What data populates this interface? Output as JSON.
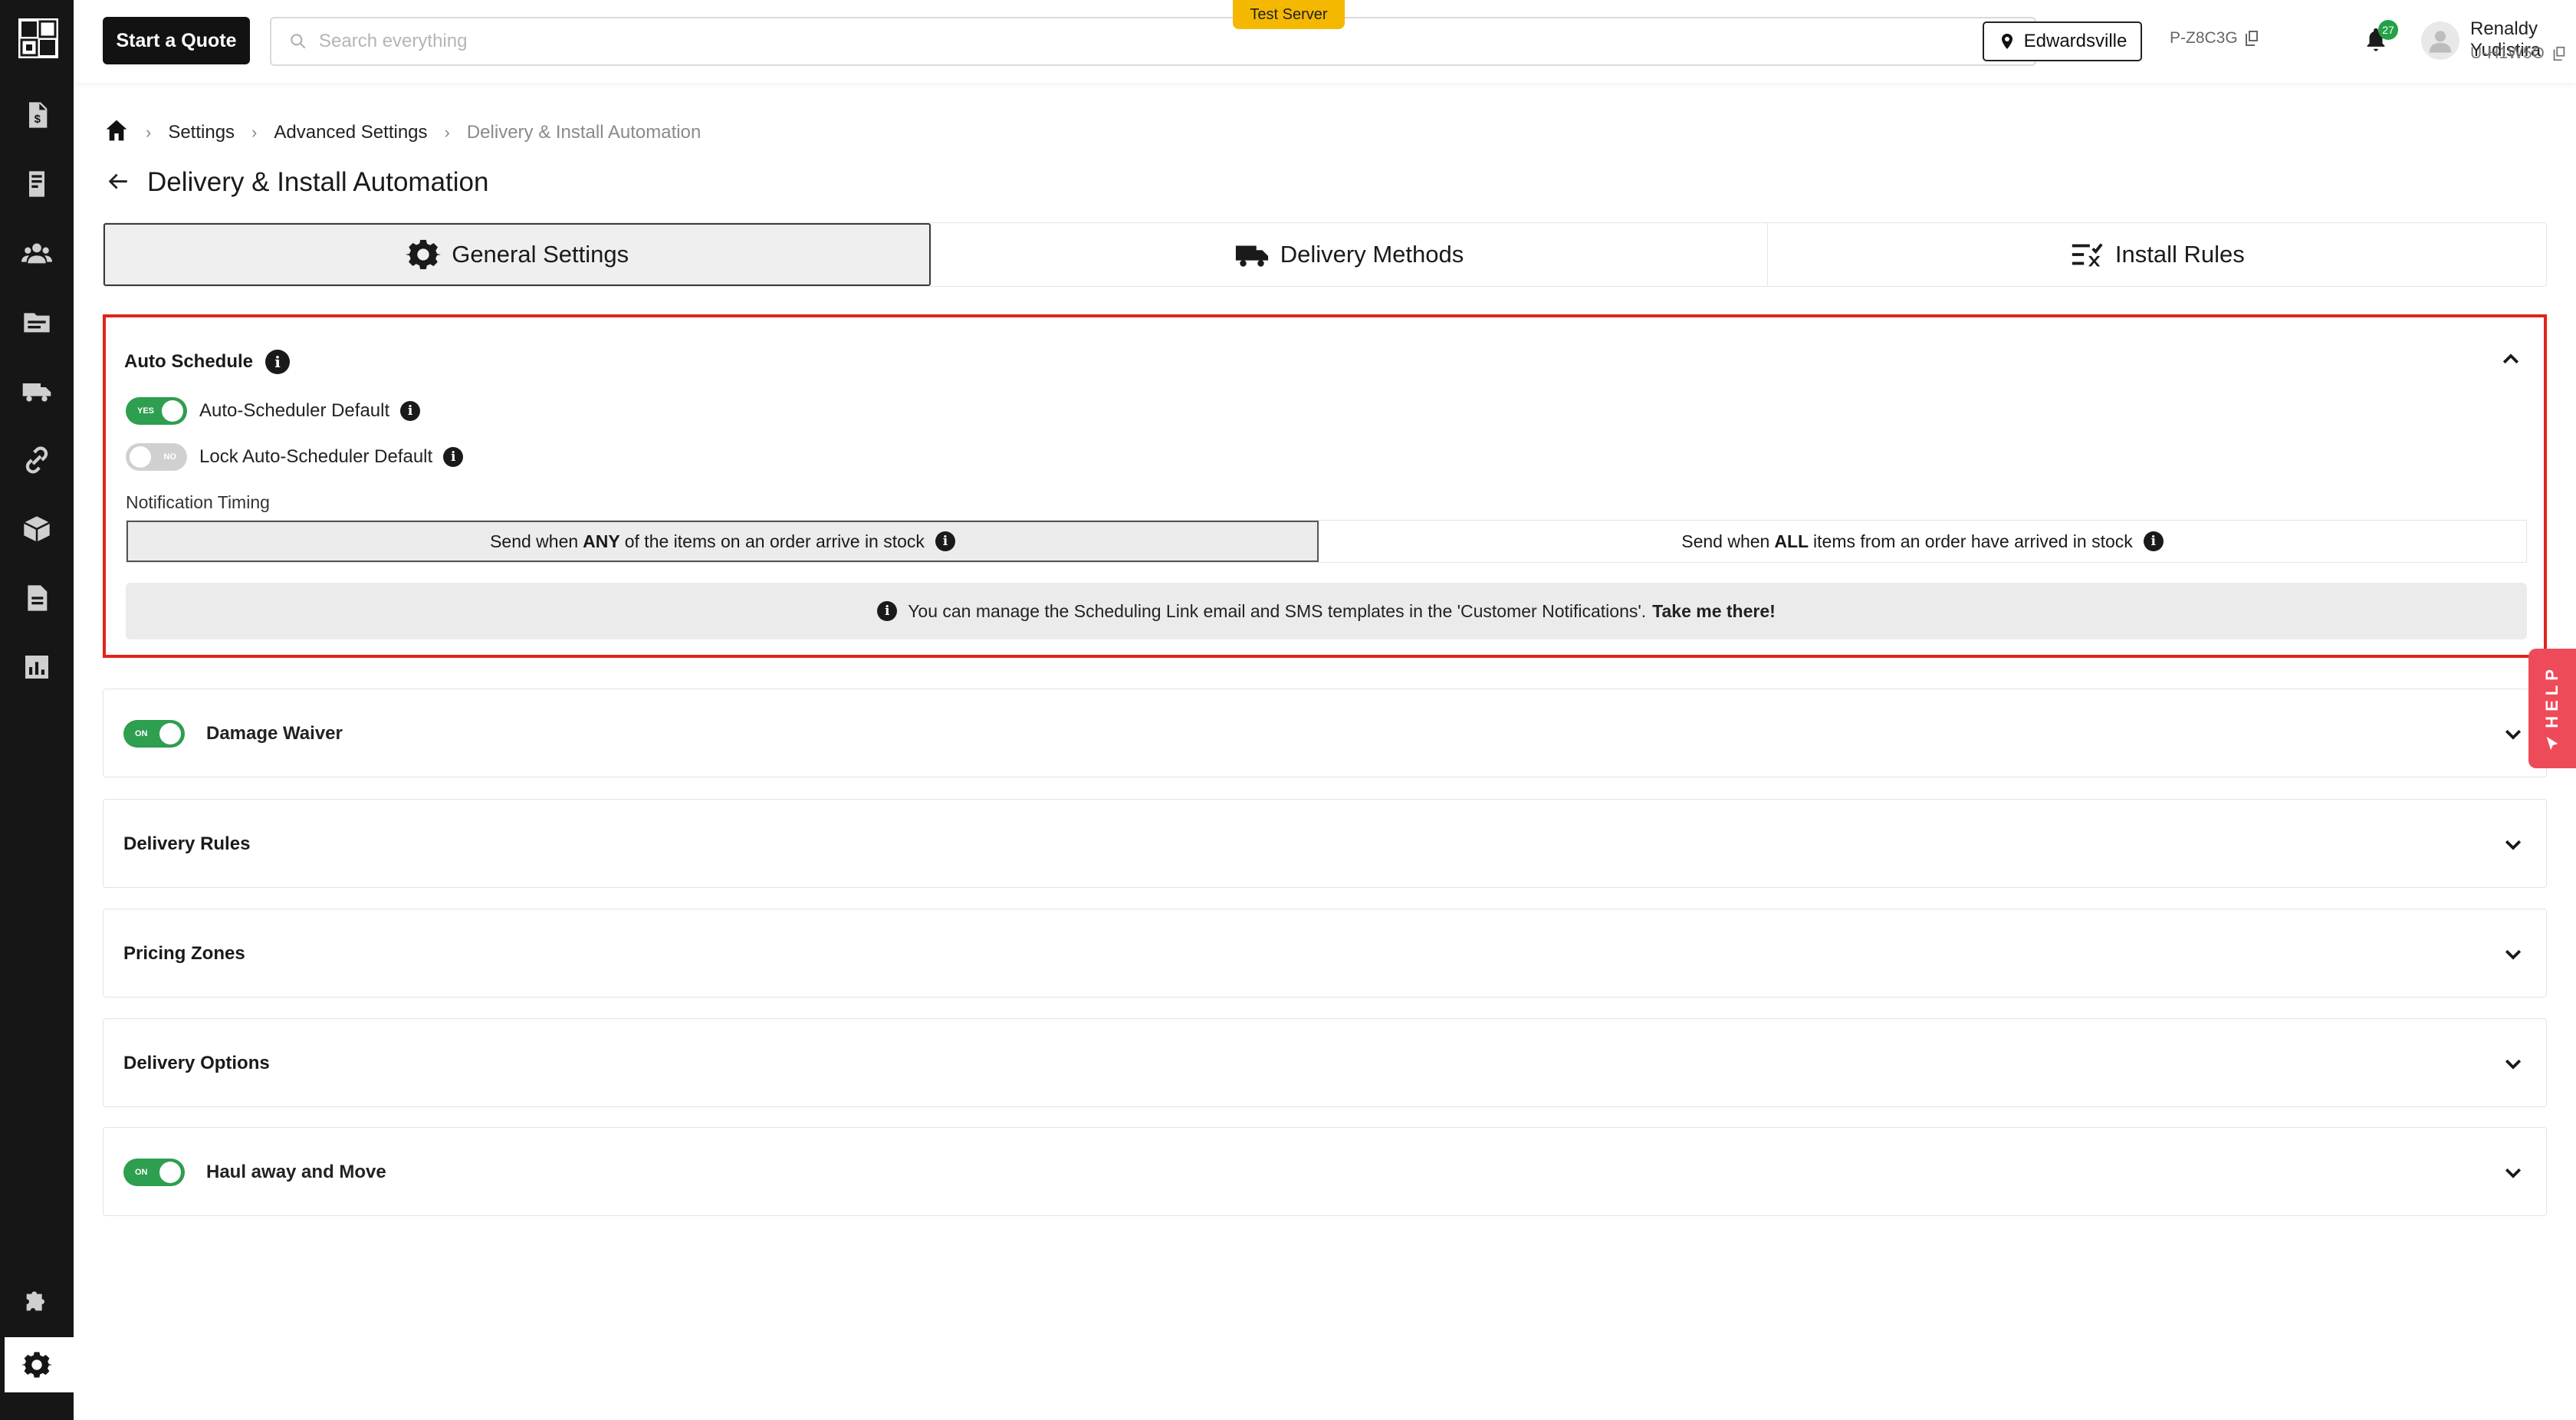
{
  "topbar": {
    "quote_button": "Start a Quote",
    "search_placeholder": "Search everything",
    "server_badge": "Test Server",
    "location": "Edwardsville",
    "project_code": "P-Z8C3G",
    "notification_count": "27",
    "user_name": "Renaldy Yudistira",
    "user_id": "U-H1W5O"
  },
  "sidebar": {
    "items": [
      {
        "icon": "invoice-icon"
      },
      {
        "icon": "register-icon"
      },
      {
        "icon": "customers-icon"
      },
      {
        "icon": "folder-icon"
      },
      {
        "icon": "truck-icon"
      },
      {
        "icon": "link-icon"
      },
      {
        "icon": "box-icon"
      },
      {
        "icon": "document-icon"
      },
      {
        "icon": "chart-icon"
      },
      {
        "icon": "puzzle-icon"
      },
      {
        "icon": "gear-icon",
        "active": true
      }
    ]
  },
  "breadcrumb": {
    "items": [
      "Settings",
      "Advanced Settings",
      "Delivery & Install Automation"
    ]
  },
  "page": {
    "title": "Delivery & Install Automation"
  },
  "tabs": [
    {
      "label": "General Settings",
      "icon": "gear-icon",
      "active": true
    },
    {
      "label": "Delivery Methods",
      "icon": "truck-icon"
    },
    {
      "label": "Install Rules",
      "icon": "list-check-icon"
    }
  ],
  "auto_schedule": {
    "title": "Auto Schedule",
    "toggle1": {
      "label": "Auto-Scheduler Default",
      "state": "YES"
    },
    "toggle2": {
      "label": "Lock Auto-Scheduler Default",
      "state": "NO"
    },
    "notification_label": "Notification Timing",
    "option1": {
      "pre": "Send when",
      "bold": "ANY",
      "post": "of the items on an order arrive in stock",
      "selected": true
    },
    "option2": {
      "pre": "Send when",
      "bold": "ALL",
      "post": "items from an order have arrived in stock"
    },
    "notice": {
      "text": "You can manage the Scheduling Link email and SMS templates in the 'Customer Notifications'.",
      "link": "Take me there!"
    }
  },
  "sections": [
    {
      "title": "Damage Waiver",
      "toggle": "ON"
    },
    {
      "title": "Delivery Rules"
    },
    {
      "title": "Pricing Zones"
    },
    {
      "title": "Delivery Options"
    },
    {
      "title": "Haul away and Move",
      "toggle": "ON"
    }
  ],
  "help": {
    "label": "HELP"
  },
  "colors": {
    "accent_dark": "#121212",
    "toggle_on": "#2e9e4f",
    "highlight_border": "#e2231a",
    "badge_yellow": "#f5b800",
    "help_tab": "#ee4b5a"
  }
}
